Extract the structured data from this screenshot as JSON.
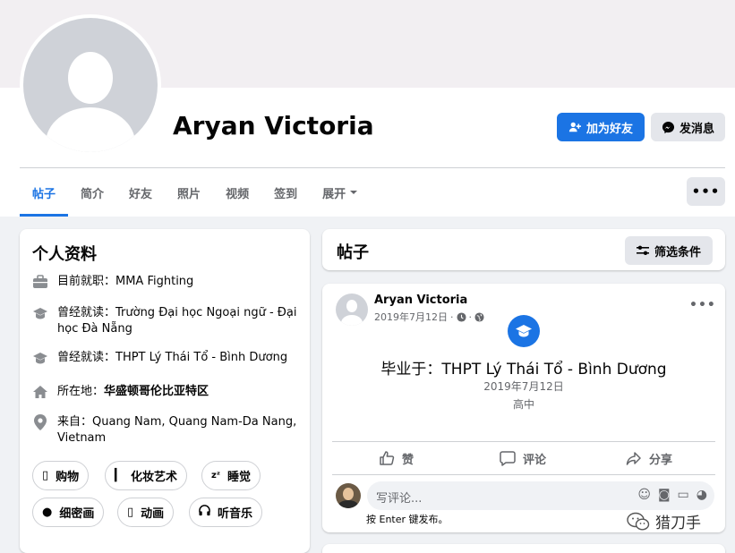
{
  "profile": {
    "name": "Aryan Victoria",
    "add_friend_label": "加为好友",
    "message_label": "发消息",
    "more_label": "•••"
  },
  "tabs": [
    {
      "label": "帖子",
      "active": true
    },
    {
      "label": "简介"
    },
    {
      "label": "好友"
    },
    {
      "label": "照片"
    },
    {
      "label": "视频"
    },
    {
      "label": "签到"
    },
    {
      "label": "展开",
      "has_chevron": true
    }
  ],
  "intro": {
    "title": "个人资料",
    "items": [
      {
        "icon": "briefcase-icon",
        "text": "目前就职：MMA Fighting"
      },
      {
        "icon": "graduation-cap-icon",
        "text": "曾经就读：Trường Đại học Ngoại ngữ - Đại học Đà Nẵng"
      },
      {
        "icon": "graduation-cap-icon",
        "text": "曾经就读：THPT Lý Thái Tổ - Bình Dương"
      },
      {
        "icon": "home-icon",
        "text_prefix": "所在地：",
        "text_bold": "华盛顿哥伦比亚特区"
      },
      {
        "icon": "location-pin-icon",
        "text": "来自：Quang Nam, Quang Nam-Da Nang, Vietnam"
      }
    ],
    "hobbies": [
      {
        "icon": "shopping-icon",
        "label": "购物"
      },
      {
        "icon": "makeup-icon",
        "label": "化妆艺术"
      },
      {
        "icon": "sleep-icon",
        "label": "睡觉"
      },
      {
        "icon": "knitting-icon",
        "label": "细密画"
      },
      {
        "icon": "animation-icon",
        "label": "动画"
      },
      {
        "icon": "headphones-icon",
        "label": "听音乐"
      }
    ]
  },
  "posts": {
    "title": "帖子",
    "filter_label": "筛选条件"
  },
  "post": {
    "author": "Aryan Victoria",
    "date": "2019年7月12日",
    "meta_sep": "·",
    "graduation_line": "毕业于：THPT Lý Thái Tổ - Bình Dương",
    "graduation_date": "2019年7月12日",
    "graduation_level": "高中",
    "like_label": "赞",
    "comment_label": "评论",
    "share_label": "分享",
    "comment_placeholder": "写评论...",
    "enter_hint": "按 Enter 键发布。",
    "more_label": "•••"
  },
  "watermark": {
    "text": "猎刀手"
  },
  "colors": {
    "accent": "#1b74e4",
    "background": "#f0f2f5",
    "cover": "#f2eff2"
  }
}
